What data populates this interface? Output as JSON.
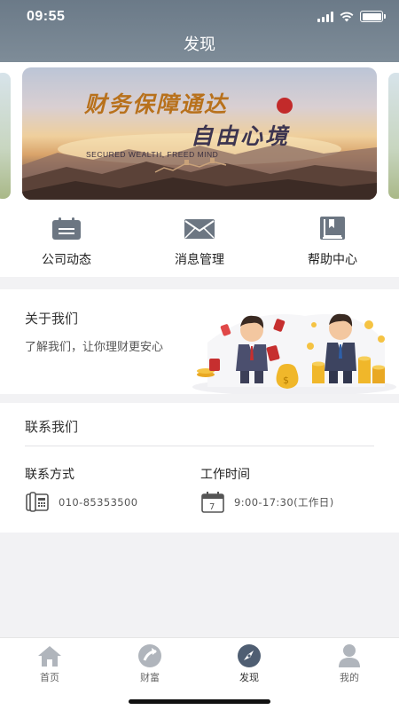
{
  "status_bar": {
    "time": "09:55"
  },
  "header": {
    "title": "发现"
  },
  "banner": {
    "headline_1": "财务保障通达",
    "headline_2": "自由心境",
    "subtitle": "SECURED  WEALTH, FREED MIND"
  },
  "quick_menu": [
    {
      "label": "公司动态",
      "icon": "calendar-icon"
    },
    {
      "label": "消息管理",
      "icon": "envelope-icon"
    },
    {
      "label": "帮助中心",
      "icon": "book-icon"
    }
  ],
  "about": {
    "title": "关于我们",
    "description": "了解我们，让你理财更安心"
  },
  "contact": {
    "title": "联系我们",
    "phone_label": "联系方式",
    "phone_value": "010-85353500",
    "hours_label": "工作时间",
    "hours_value": "9:00-17:30(工作日)",
    "calendar_day": "7"
  },
  "tabbar": {
    "active": "发现",
    "tabs": [
      {
        "label": "首页",
        "icon": "home-icon"
      },
      {
        "label": "财富",
        "icon": "wealth-icon"
      },
      {
        "label": "发现",
        "icon": "compass-icon"
      },
      {
        "label": "我的",
        "icon": "user-icon"
      }
    ]
  },
  "colors": {
    "header_bg": "#6b7a88",
    "icon_gray": "#6c7682",
    "banner_gold": "#b8711c"
  }
}
